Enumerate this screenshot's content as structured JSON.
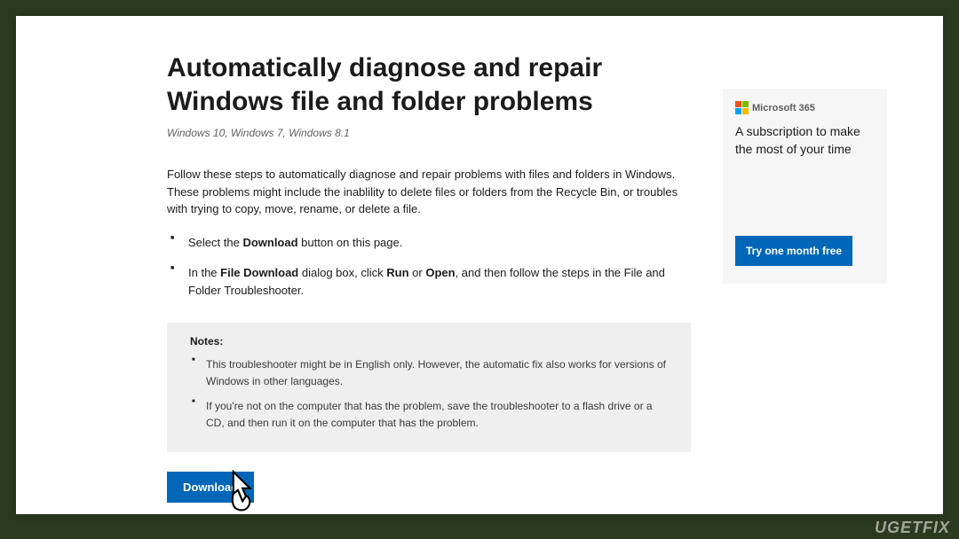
{
  "main": {
    "heading": "Automatically diagnose and repair Windows file and folder problems",
    "applies_to": "Windows 10, Windows 7, Windows 8.1",
    "intro": "Follow these steps to automatically diagnose and repair problems with files and folders in Windows. These problems might include the inablility to delete files or folders from the Recycle Bin, or troubles with trying to copy, move, rename, or delete a file.",
    "steps": {
      "s1_before": "Select the ",
      "s1_bold": "Download",
      "s1_after": " button on this page.",
      "s2_before": "In the ",
      "s2_bold1": "File Download",
      "s2_mid": " dialog box, click ",
      "s2_bold2": "Run",
      "s2_or": " or ",
      "s2_bold3": "Open",
      "s2_after": ", and then follow the steps in the File and Folder Troubleshooter."
    },
    "notes": {
      "title": "Notes:",
      "n1": "This troubleshooter might be in English only. However, the automatic fix also works for versions of Windows in other languages.",
      "n2": "If you're not on the computer that has the problem, save the troubleshooter to a flash drive or a CD, and then run it on the computer that has the problem."
    },
    "download_label": "Download"
  },
  "aside": {
    "logo_text": "Microsoft 365",
    "message": "A subscription to make the most of your time",
    "cta_label": "Try one month free"
  },
  "watermark": "UGETFIX"
}
